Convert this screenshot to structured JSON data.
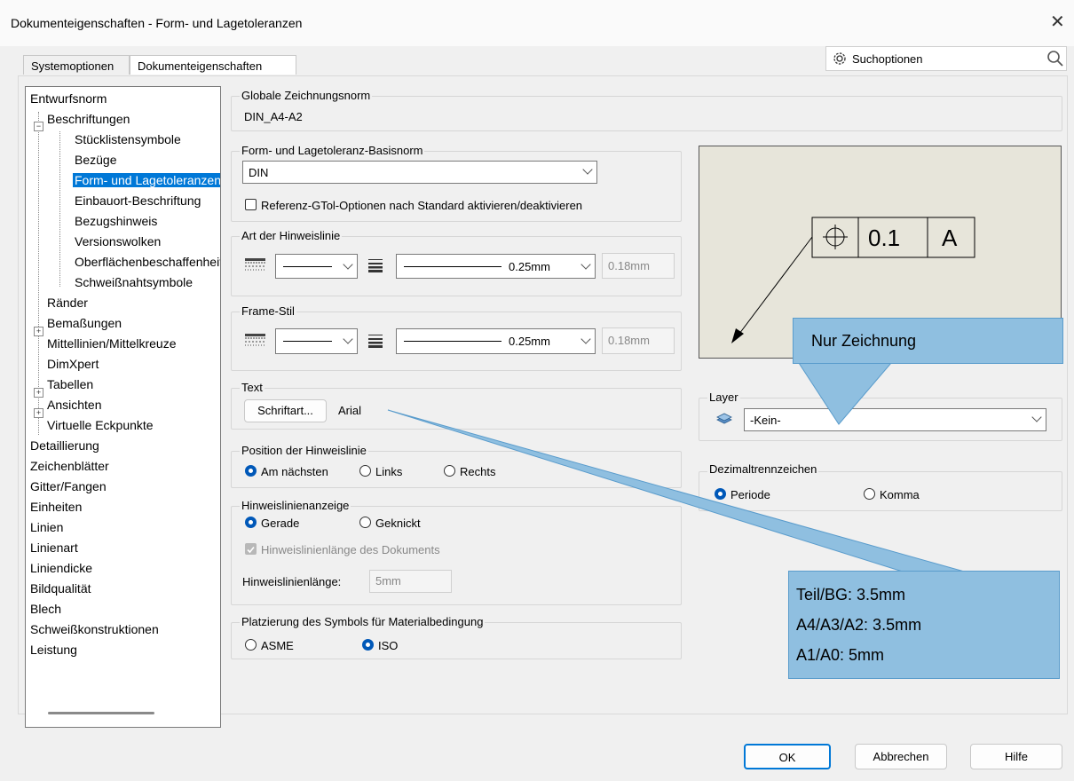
{
  "window": {
    "title": "Dokumenteigenschaften - Form- und Lagetoleranzen",
    "close": "✕"
  },
  "tabs": [
    {
      "label": "Systemoptionen"
    },
    {
      "label": "Dokumenteigenschaften"
    }
  ],
  "search": {
    "label": "Suchoptionen"
  },
  "tree": {
    "items": [
      "Entwurfsnorm",
      "Beschriftungen",
      "Stücklistensymbole",
      "Bezüge",
      "Form- und Lagetoleranzen",
      "Einbauort-Beschriftung",
      "Bezugshinweis",
      "Versionswolken",
      "Oberflächenbeschaffenheit",
      "Schweißnahtsymbole",
      "Ränder",
      "Bemaßungen",
      "Mittellinien/Mittelkreuze",
      "DimXpert",
      "Tabellen",
      "Ansichten",
      "Virtuelle Eckpunkte",
      "Detaillierung",
      "Zeichenblätter",
      "Gitter/Fangen",
      "Einheiten",
      "Linien",
      "Linienart",
      "Liniendicke",
      "Bildqualität",
      "Blech",
      "Schweißkonstruktionen",
      "Leistung"
    ],
    "selected_index": 4
  },
  "global_norm": {
    "label": "Globale Zeichnungsnorm",
    "value": "DIN_A4-A2"
  },
  "basis_norm": {
    "label": "Form- und Lagetoleranz-Basisnorm",
    "value": "DIN",
    "checkbox_label": "Referenz-GTol-Optionen nach Standard aktivieren/deaktivieren",
    "checked": false
  },
  "leader_style": {
    "label": "Art der Hinweislinie",
    "thickness": "0.25mm",
    "custom": "0.18mm"
  },
  "frame_style": {
    "label": "Frame-Stil",
    "thickness": "0.25mm",
    "custom": "0.18mm"
  },
  "text": {
    "label": "Text",
    "font_button": "Schriftart...",
    "font_name": "Arial"
  },
  "leader_position": {
    "label": "Position der Hinweislinie",
    "options": [
      "Am nächsten",
      "Links",
      "Rechts"
    ],
    "selected": 0
  },
  "leader_display": {
    "label": "Hinweislinienanzeige",
    "options": [
      "Gerade",
      "Geknickt"
    ],
    "selected": 0,
    "doc_length_label": "Hinweislinienlänge des Dokuments",
    "doc_length_checked": true,
    "length_label": "Hinweislinienlänge:",
    "length_value": "5mm"
  },
  "material_symbol": {
    "label": "Platzierung des Symbols für Materialbedingung",
    "options": [
      "ASME",
      "ISO"
    ],
    "selected": 1
  },
  "preview": {
    "tolerance": "0.1",
    "datum": "A"
  },
  "layer": {
    "label": "Layer",
    "value": "-Kein-"
  },
  "decimal": {
    "label": "Dezimaltrennzeichen",
    "options": [
      "Periode",
      "Komma"
    ],
    "selected": 0
  },
  "callouts": {
    "drawing_only": "Nur Zeichnung",
    "text_lines": [
      "Teil/BG: 3.5mm",
      "A4/A3/A2: 3.5mm",
      "A1/A0: 5mm"
    ]
  },
  "buttons": {
    "ok": "OK",
    "cancel": "Abbrechen",
    "help": "Hilfe"
  },
  "colors": {
    "accent": "#0078d7",
    "callout": "#8fbfe0",
    "preview_bg": "#e7e5da"
  }
}
